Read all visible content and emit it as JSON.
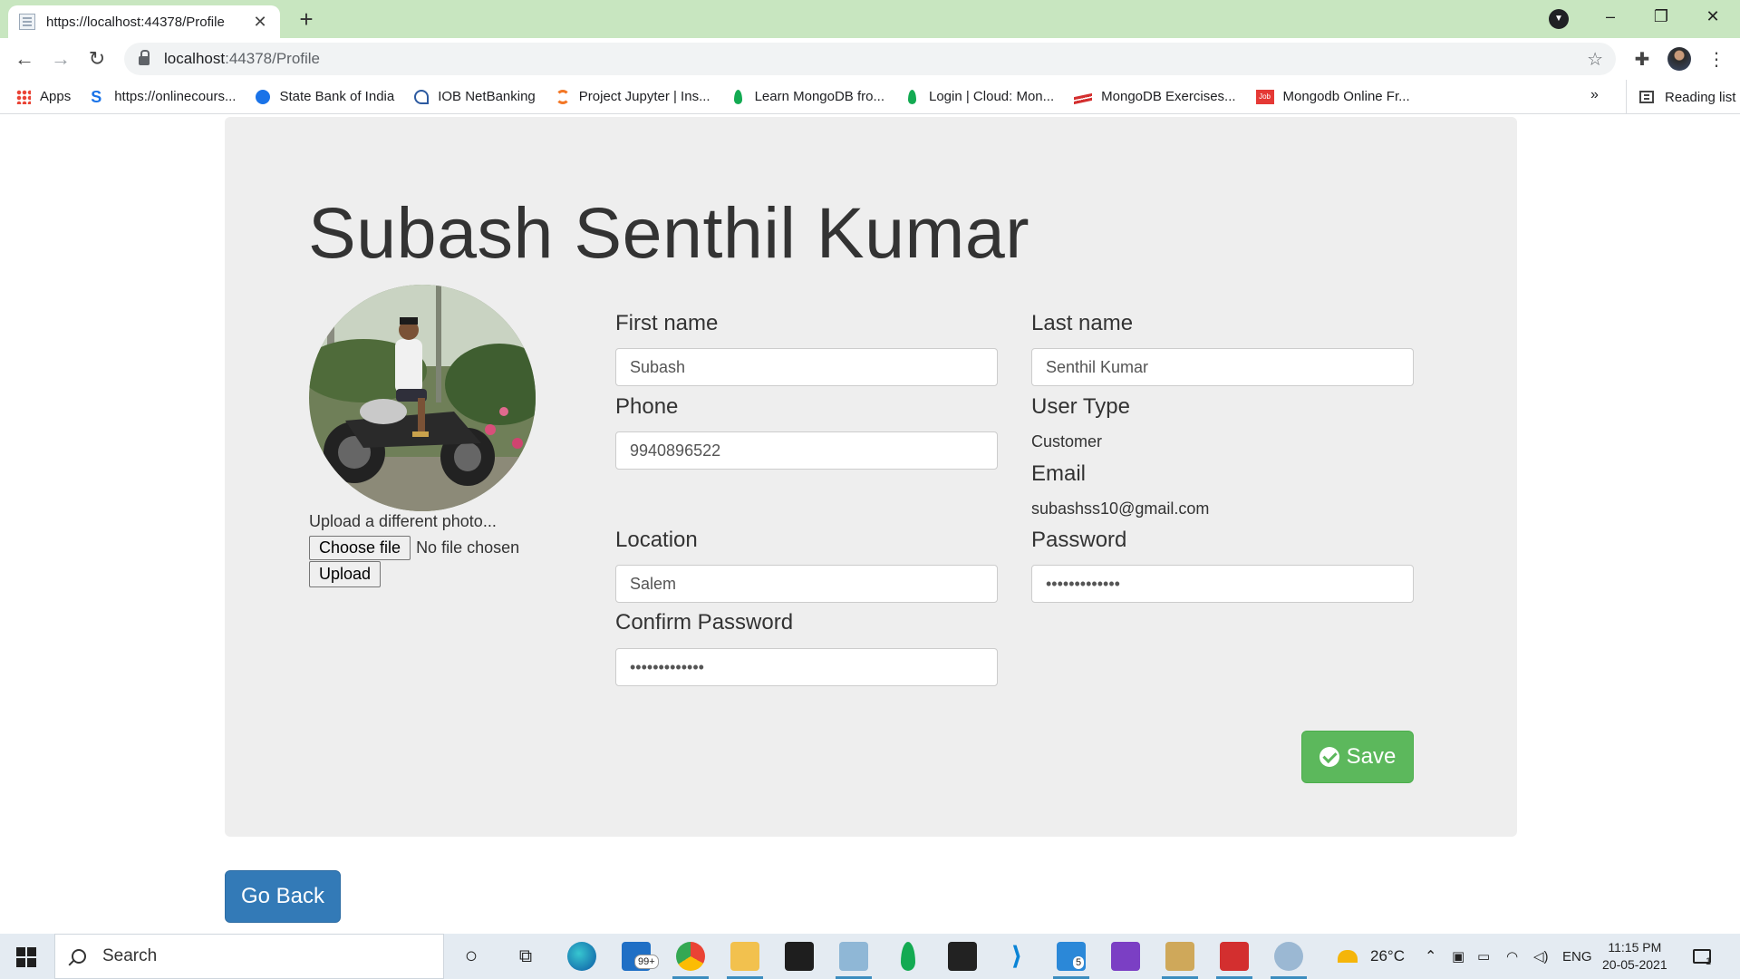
{
  "browser": {
    "tab_title": "https://localhost:44378/Profile",
    "url_host": "localhost",
    "url_path": ":44378/Profile",
    "bookmarks": [
      {
        "label": "Apps",
        "icon": "apps-grid-icon",
        "color": "#ea4335"
      },
      {
        "label": "https://onlinecours...",
        "icon": "s-logo-icon",
        "color": "#1a73e8"
      },
      {
        "label": "State Bank of India",
        "icon": "sbi-icon",
        "color": "#1a73e8"
      },
      {
        "label": "IOB NetBanking",
        "icon": "iob-icon",
        "color": "#2c5aa0"
      },
      {
        "label": "Project Jupyter | Ins...",
        "icon": "jupyter-icon",
        "color": "#f37726"
      },
      {
        "label": "Learn MongoDB fro...",
        "icon": "mongodb-leaf-icon",
        "color": "#13aa52"
      },
      {
        "label": "Login | Cloud: Mon...",
        "icon": "mongodb-leaf-icon",
        "color": "#13aa52"
      },
      {
        "label": "MongoDB Exercises...",
        "icon": "w3resource-icon",
        "color": "#d32f2f"
      },
      {
        "label": "Mongodb Online Fr...",
        "icon": "job-icon",
        "color": "#e53935"
      }
    ],
    "more_label": "»",
    "reading_list": "Reading list"
  },
  "profile": {
    "name": "Subash Senthil Kumar",
    "upload_label": "Upload a different photo...",
    "choose_file": "Choose file",
    "no_file": "No file chosen",
    "upload_button": "Upload"
  },
  "form": {
    "first_name_label": "First name",
    "first_name_value": "Subash",
    "last_name_label": "Last name",
    "last_name_value": "Senthil Kumar",
    "phone_label": "Phone",
    "phone_value": "9940896522",
    "user_type_label": "User Type",
    "user_type_value": "Customer",
    "email_label": "Email",
    "email_value": "subashss10@gmail.com",
    "location_label": "Location",
    "location_value": "Salem",
    "password_label": "Password",
    "password_value": "•••••••••••••",
    "confirm_label": "Confirm Password",
    "confirm_value": "•••••••••••••",
    "save_label": "Save"
  },
  "go_back": "Go Back",
  "taskbar": {
    "search": "Search",
    "mail_badge": "99+",
    "notes_badge": "5",
    "weather": "26°C",
    "lang": "ENG",
    "time": "11:15 PM",
    "date": "20-05-2021",
    "notif_count": "1"
  },
  "colors": {
    "save": "#5cb85c",
    "go_back": "#337ab7",
    "tabstrip": "#c8e6c0",
    "jumbotron": "#eeeeee"
  }
}
